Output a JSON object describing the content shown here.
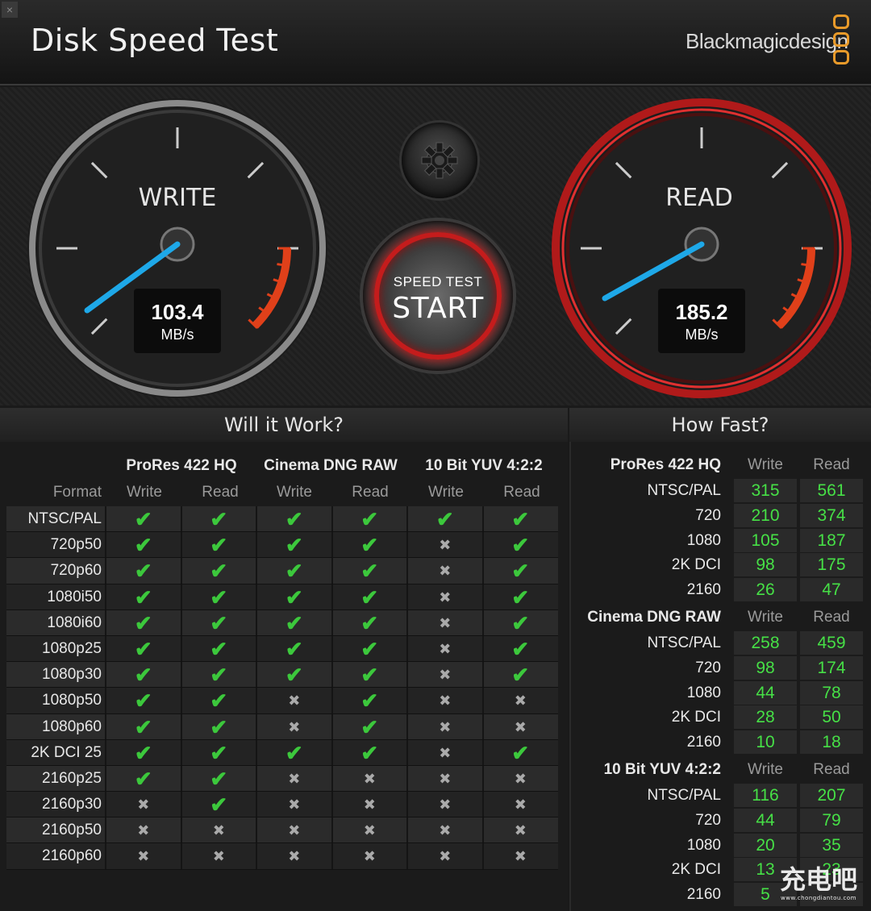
{
  "window": {
    "title": "Disk Speed Test",
    "brand": "Blackmagicdesign",
    "close_glyph": "×"
  },
  "gauges": {
    "write": {
      "label": "WRITE",
      "value": "103.4",
      "unit": "MB/s",
      "accent": "#1ea8e8"
    },
    "read": {
      "label": "READ",
      "value": "185.2",
      "unit": "MB/s",
      "accent": "#1ea8e8"
    }
  },
  "start_button": {
    "small_label": "SPEED TEST",
    "big_label": "START"
  },
  "settings_icon": "gear-icon",
  "will_it_work": {
    "title": "Will it Work?",
    "format_header": "Format",
    "groups": [
      "ProRes 422 HQ",
      "Cinema DNG RAW",
      "10 Bit YUV 4:2:2"
    ],
    "sub_headers": [
      "Write",
      "Read",
      "Write",
      "Read",
      "Write",
      "Read"
    ],
    "glyphs": {
      "yes": "✔",
      "no": "✖"
    },
    "rows": [
      {
        "format": "NTSC/PAL",
        "marks": [
          1,
          1,
          1,
          1,
          1,
          1
        ]
      },
      {
        "format": "720p50",
        "marks": [
          1,
          1,
          1,
          1,
          0,
          1
        ]
      },
      {
        "format": "720p60",
        "marks": [
          1,
          1,
          1,
          1,
          0,
          1
        ]
      },
      {
        "format": "1080i50",
        "marks": [
          1,
          1,
          1,
          1,
          0,
          1
        ]
      },
      {
        "format": "1080i60",
        "marks": [
          1,
          1,
          1,
          1,
          0,
          1
        ]
      },
      {
        "format": "1080p25",
        "marks": [
          1,
          1,
          1,
          1,
          0,
          1
        ]
      },
      {
        "format": "1080p30",
        "marks": [
          1,
          1,
          1,
          1,
          0,
          1
        ]
      },
      {
        "format": "1080p50",
        "marks": [
          1,
          1,
          0,
          1,
          0,
          0
        ]
      },
      {
        "format": "1080p60",
        "marks": [
          1,
          1,
          0,
          1,
          0,
          0
        ]
      },
      {
        "format": "2K DCI 25",
        "marks": [
          1,
          1,
          1,
          1,
          0,
          1
        ]
      },
      {
        "format": "2160p25",
        "marks": [
          1,
          1,
          0,
          0,
          0,
          0
        ]
      },
      {
        "format": "2160p30",
        "marks": [
          0,
          1,
          0,
          0,
          0,
          0
        ]
      },
      {
        "format": "2160p50",
        "marks": [
          0,
          0,
          0,
          0,
          0,
          0
        ]
      },
      {
        "format": "2160p60",
        "marks": [
          0,
          0,
          0,
          0,
          0,
          0
        ]
      }
    ]
  },
  "how_fast": {
    "title": "How Fast?",
    "write_header": "Write",
    "read_header": "Read",
    "groups": [
      {
        "name": "ProRes 422 HQ",
        "rows": [
          {
            "format": "NTSC/PAL",
            "write": "315",
            "read": "561"
          },
          {
            "format": "720",
            "write": "210",
            "read": "374"
          },
          {
            "format": "1080",
            "write": "105",
            "read": "187"
          },
          {
            "format": "2K DCI",
            "write": "98",
            "read": "175"
          },
          {
            "format": "2160",
            "write": "26",
            "read": "47"
          }
        ]
      },
      {
        "name": "Cinema DNG RAW",
        "rows": [
          {
            "format": "NTSC/PAL",
            "write": "258",
            "read": "459"
          },
          {
            "format": "720",
            "write": "98",
            "read": "174"
          },
          {
            "format": "1080",
            "write": "44",
            "read": "78"
          },
          {
            "format": "2K DCI",
            "write": "28",
            "read": "50"
          },
          {
            "format": "2160",
            "write": "10",
            "read": "18"
          }
        ]
      },
      {
        "name": "10 Bit YUV 4:2:2",
        "rows": [
          {
            "format": "NTSC/PAL",
            "write": "116",
            "read": "207"
          },
          {
            "format": "720",
            "write": "44",
            "read": "79"
          },
          {
            "format": "1080",
            "write": "20",
            "read": "35"
          },
          {
            "format": "2K DCI",
            "write": "13",
            "read": "23"
          },
          {
            "format": "2160",
            "write": "5",
            "read": ""
          }
        ]
      }
    ]
  },
  "watermark": {
    "text": "充电吧",
    "url_text": "www.chongdiantou.com"
  }
}
